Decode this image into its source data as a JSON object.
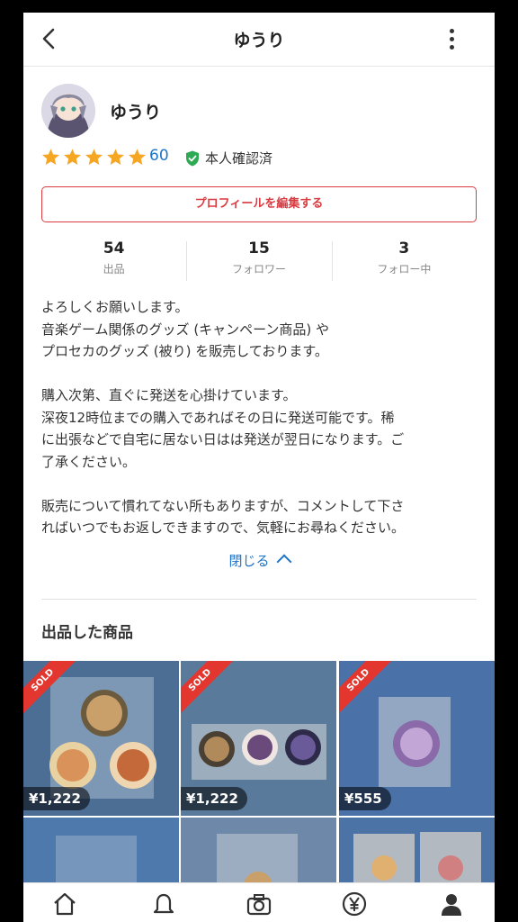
{
  "header": {
    "title": "ゆうり",
    "back_icon": "chevron-left-icon",
    "menu_icon": "more-vertical-icon"
  },
  "profile": {
    "name": "ゆうり",
    "rating_stars": 5,
    "rating_count": "60",
    "verified_label": "本人確認済",
    "edit_button": "プロフィールを編集する"
  },
  "stats": [
    {
      "value": "54",
      "label": "出品"
    },
    {
      "value": "15",
      "label": "フォロワー"
    },
    {
      "value": "3",
      "label": "フォロー中"
    }
  ],
  "bio": {
    "line1": "よろしくお願いします。",
    "line2": "音楽ゲーム関係のグッズ (キャンペーン商品) や",
    "line3": "プロセカのグッズ (被り) を販売しております。",
    "line4": "購入次第、直ぐに発送を心掛けています。",
    "line5": "深夜12時位までの購入であればその日に発送可能です。稀",
    "line6": "に出張などで自宅に居ない日はは発送が翌日になります。ご",
    "line7": "了承ください。",
    "line8": "販売について慣れてない所もありますが、コメントして下さ",
    "line9": "ればいつでもお返しできますので、気軽にお尋ねください。"
  },
  "close_label": "閉じる",
  "listings_title": "出品した商品",
  "listings": [
    {
      "sold": "SOLD",
      "price": "¥1,222"
    },
    {
      "sold": "SOLD",
      "price": "¥1,222"
    },
    {
      "sold": "SOLD",
      "price": "¥555"
    }
  ],
  "nav": [
    "home-icon",
    "bell-icon",
    "camera-icon",
    "yen-icon",
    "person-icon"
  ],
  "colors": {
    "accent_red": "#d93b40",
    "link_blue": "#1e74c9",
    "star": "#f5a623",
    "verified_green": "#2eaa55"
  }
}
